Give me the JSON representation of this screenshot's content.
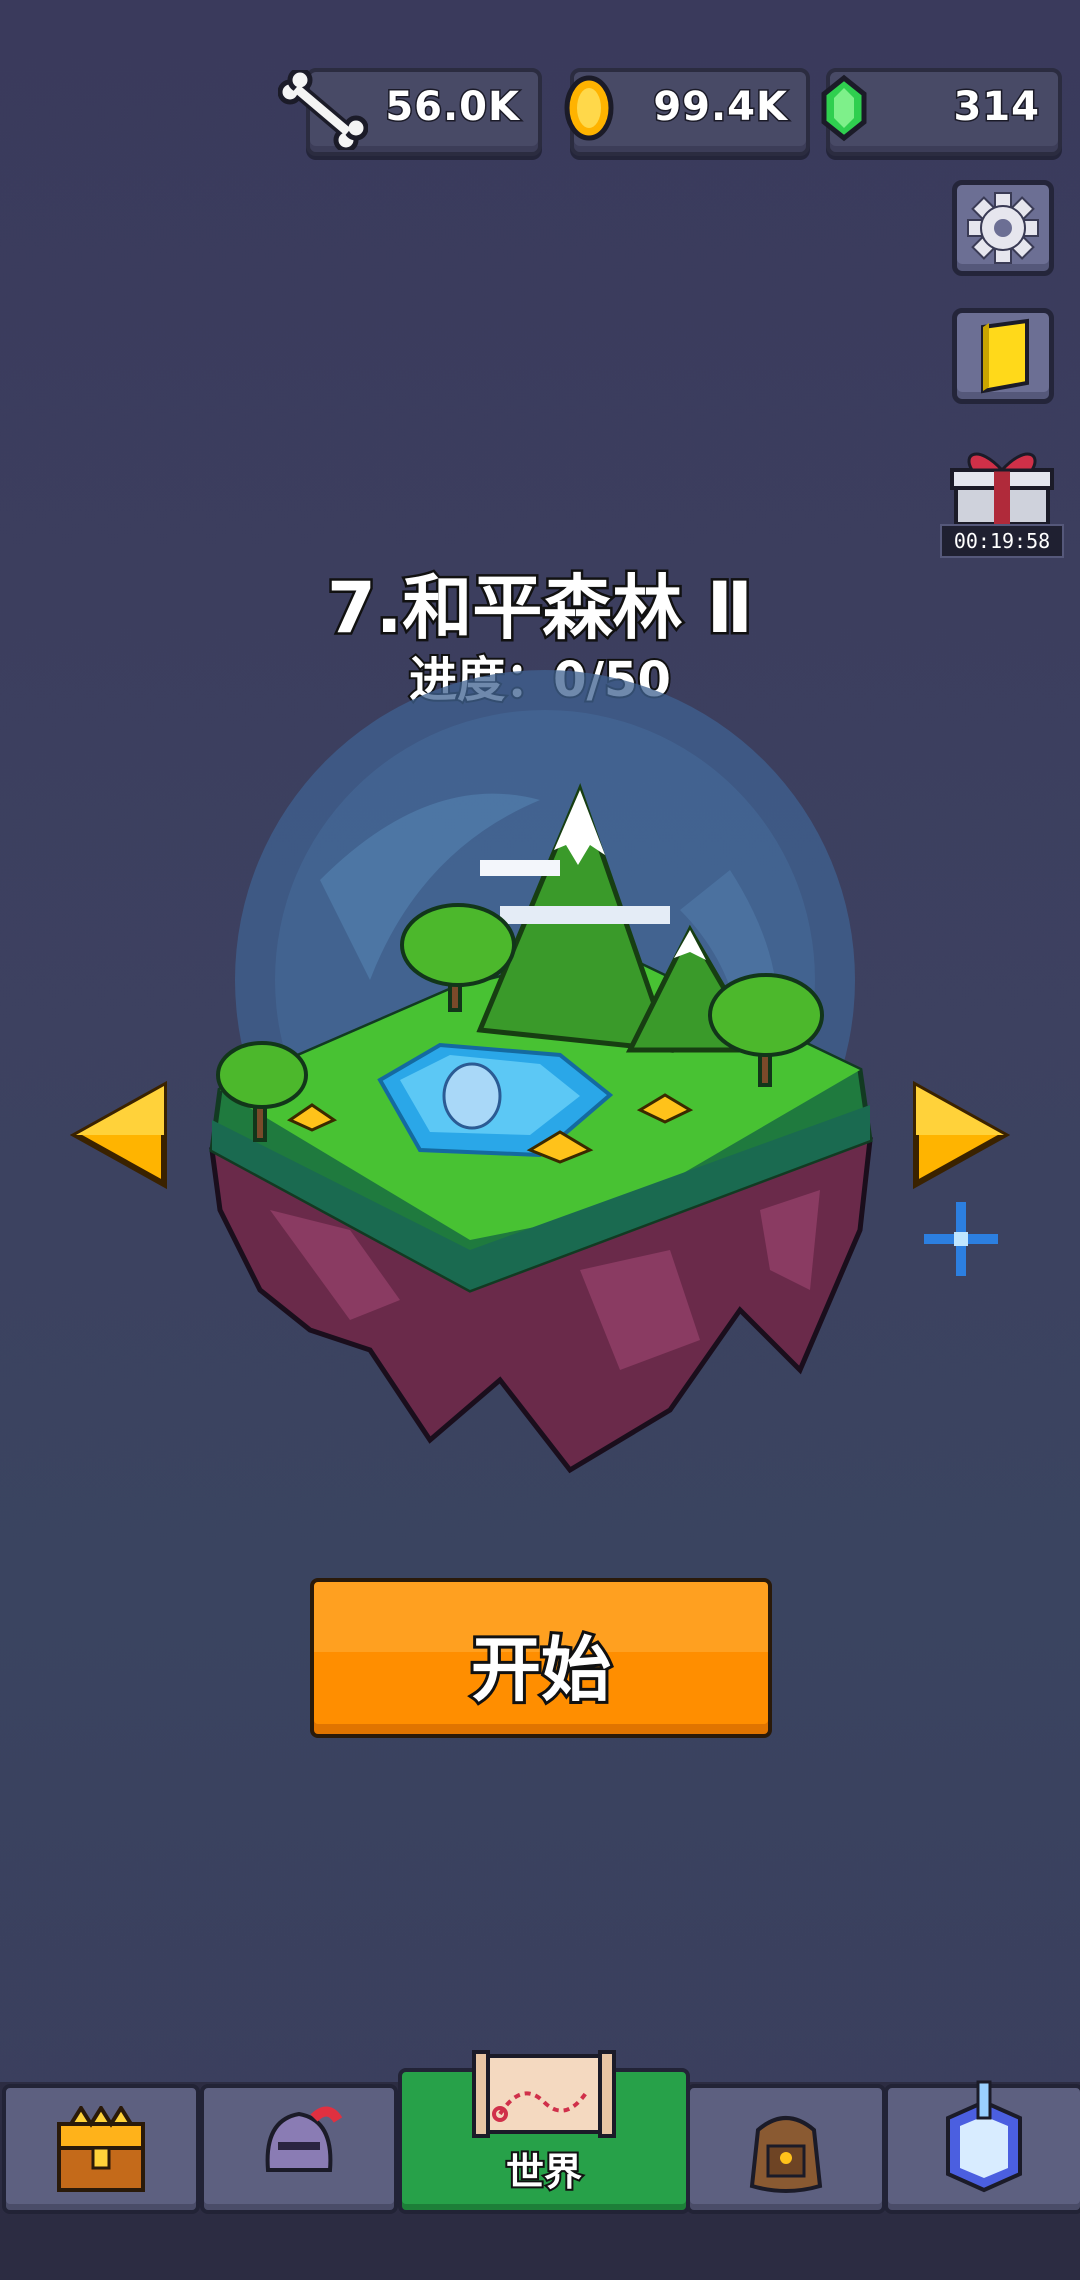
{
  "resources": {
    "bones": {
      "value": "56.0K",
      "icon": "bone-icon"
    },
    "coins": {
      "value": "99.4K",
      "icon": "coin-icon"
    },
    "gems": {
      "value": "314",
      "icon": "gem-icon"
    }
  },
  "side_buttons": {
    "settings_icon": "gear-icon",
    "book_icon": "book-icon",
    "gift_icon": "gift-icon",
    "gift_timer": "00:19:58"
  },
  "level": {
    "title": "7.和平森林 Ⅱ",
    "progress": "进度：0/50"
  },
  "start_button": "开始",
  "nav": {
    "tabs": [
      {
        "icon": "treasure-chest-icon",
        "label": ""
      },
      {
        "icon": "knight-helmet-icon",
        "label": ""
      },
      {
        "icon": "world-map-icon",
        "label": "世界",
        "active": true
      },
      {
        "icon": "backpack-icon",
        "label": ""
      },
      {
        "icon": "crystal-portal-icon",
        "label": ""
      }
    ]
  },
  "colors": {
    "background": "#3b3d5d",
    "start_button": "#ff9a10",
    "active_tab": "#27a149",
    "arrow": "#ffb400"
  }
}
